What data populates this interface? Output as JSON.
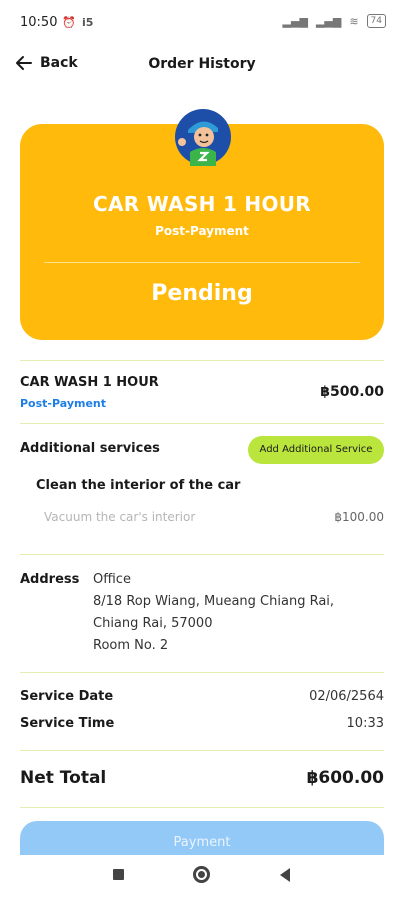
{
  "status_bar": {
    "time": "10:50",
    "icons": [
      "alarm-icon",
      "notification-icon"
    ],
    "right_icons": [
      "signal-icon",
      "signal-icon",
      "wifi-icon"
    ],
    "battery": "74"
  },
  "header": {
    "back_label": "Back",
    "title": "Order History"
  },
  "order_card": {
    "title": "CAR WASH 1 HOUR",
    "payment_type": "Post-Payment",
    "status": "Pending",
    "color": "#ffba0c"
  },
  "service": {
    "name": "CAR WASH 1 HOUR",
    "payment_type": "Post-Payment",
    "price": "฿500.00"
  },
  "additional": {
    "title": "Additional services",
    "add_button": "Add Additional Service",
    "item_title": "Clean the interior of the car",
    "item_detail": "Vacuum the car's interior",
    "item_price": "฿100.00"
  },
  "address": {
    "label": "Address",
    "lines": [
      "Office",
      "8/18 Rop Wiang, Mueang Chiang Rai,",
      "Chiang Rai, 57000",
      "Room No. 2"
    ]
  },
  "schedule": {
    "date_label": "Service Date",
    "date_value": "02/06/2564",
    "time_label": "Service Time",
    "time_value": "10:33"
  },
  "total": {
    "label": "Net Total",
    "value": "฿600.00"
  },
  "payment_button": "Payment",
  "nav": [
    "recent-apps-button",
    "home-button",
    "back-button"
  ]
}
